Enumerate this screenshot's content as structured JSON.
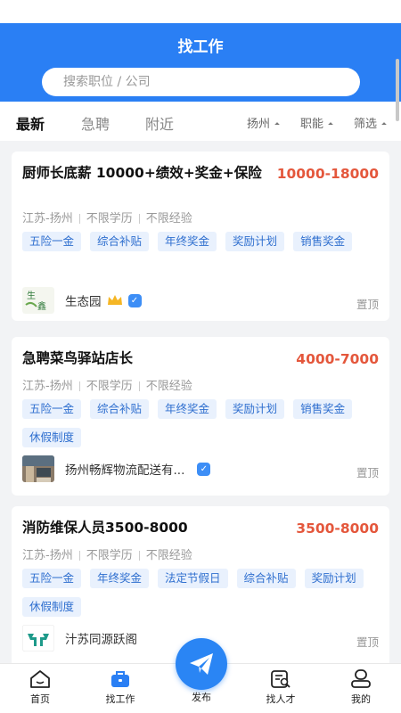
{
  "header": {
    "title": "找工作",
    "search_placeholder": "搜索职位 / 公司"
  },
  "tabs": [
    {
      "label": "最新",
      "active": true
    },
    {
      "label": "急聘",
      "active": false
    },
    {
      "label": "附近",
      "active": false
    }
  ],
  "filters": [
    {
      "label": "扬州"
    },
    {
      "label": "职能"
    },
    {
      "label": "筛选"
    }
  ],
  "jobs": [
    {
      "title": "厨师长底薪 10000+绩效+奖金+保险",
      "salary": "10000-18000",
      "location": "江苏-扬州",
      "education": "不限学历",
      "experience": "不限经验",
      "tags": [
        "五险一金",
        "综合补贴",
        "年终奖金",
        "奖励计划",
        "销售奖金"
      ],
      "company": "生态园",
      "logo_icon": "shengtaiyuan-logo",
      "pin": "置顶"
    },
    {
      "title": "急聘菜鸟驿站店长",
      "salary": "4000-7000",
      "location": "江苏-扬州",
      "education": "不限学历",
      "experience": "不限经验",
      "tags": [
        "五险一金",
        "综合补贴",
        "年终奖金",
        "奖励计划",
        "销售奖金",
        "休假制度"
      ],
      "company": "扬州畅辉物流配送有...",
      "logo_icon": "store-photo-logo",
      "pin": "置顶"
    },
    {
      "title": "消防维保人员3500-8000",
      "salary": "3500-8000",
      "location": "江苏-扬州",
      "education": "不限学历",
      "experience": "不限经验",
      "tags": [
        "五险一金",
        "年终奖金",
        "法定节假日",
        "综合补贴",
        "奖励计划",
        "休假制度"
      ],
      "company": "汁苏同源跃阁",
      "logo_icon": "tongyuan-logo",
      "pin": "置顶"
    }
  ],
  "nav": {
    "home": "首页",
    "jobs": "找工作",
    "publish": "发布",
    "talent": "找人才",
    "mine": "我的"
  },
  "colors": {
    "primary": "#2a7ff4",
    "salary": "#e4573c",
    "tag_bg": "#e9f1fd",
    "tag_text": "#2f6fcf"
  }
}
